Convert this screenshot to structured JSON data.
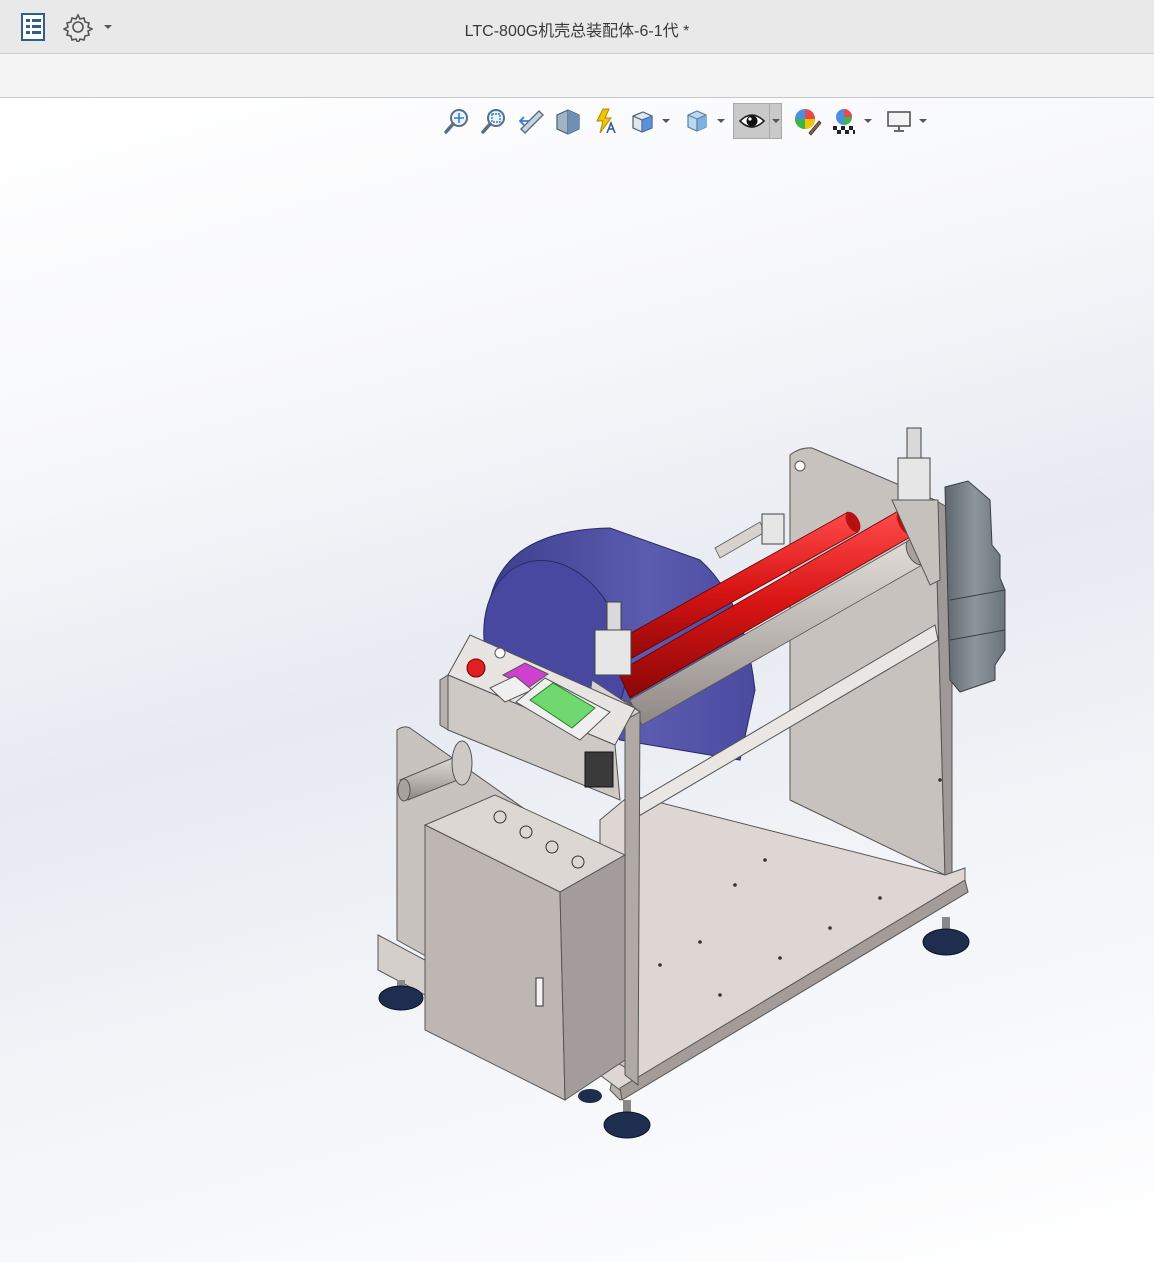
{
  "window": {
    "title": "LTC-800G机壳总装配体-6-1代 *"
  },
  "title_bar": {
    "icons": [
      "feature-manager-icon",
      "gear-icon",
      "chevron-down-icon"
    ]
  },
  "heads_up_toolbar": {
    "tools": [
      {
        "name": "zoom-to-fit-icon"
      },
      {
        "name": "zoom-to-area-icon"
      },
      {
        "name": "previous-view-icon"
      },
      {
        "name": "section-view-icon"
      },
      {
        "name": "dynamic-annotation-views-icon"
      },
      {
        "name": "view-orientation-icon",
        "dropdown": true
      },
      {
        "name": "display-style-icon",
        "dropdown": true
      },
      {
        "name": "hide-show-items-icon",
        "dropdown": true,
        "active": true
      },
      {
        "name": "edit-appearance-icon"
      },
      {
        "name": "apply-scene-icon",
        "dropdown": true
      },
      {
        "name": "view-settings-icon",
        "dropdown": true
      }
    ]
  },
  "model": {
    "name": "machine-assembly",
    "colors": {
      "frame": "#cfc9c6",
      "frame_dark": "#a49c9a",
      "roll_blue": "#5b5bb0",
      "roller_red": "#d81414",
      "roller_grey": "#bdb7b3",
      "motor": "#79838a",
      "feet": "#1f2d4f",
      "screen": "#6fd86f",
      "estop": "#e02020"
    }
  }
}
